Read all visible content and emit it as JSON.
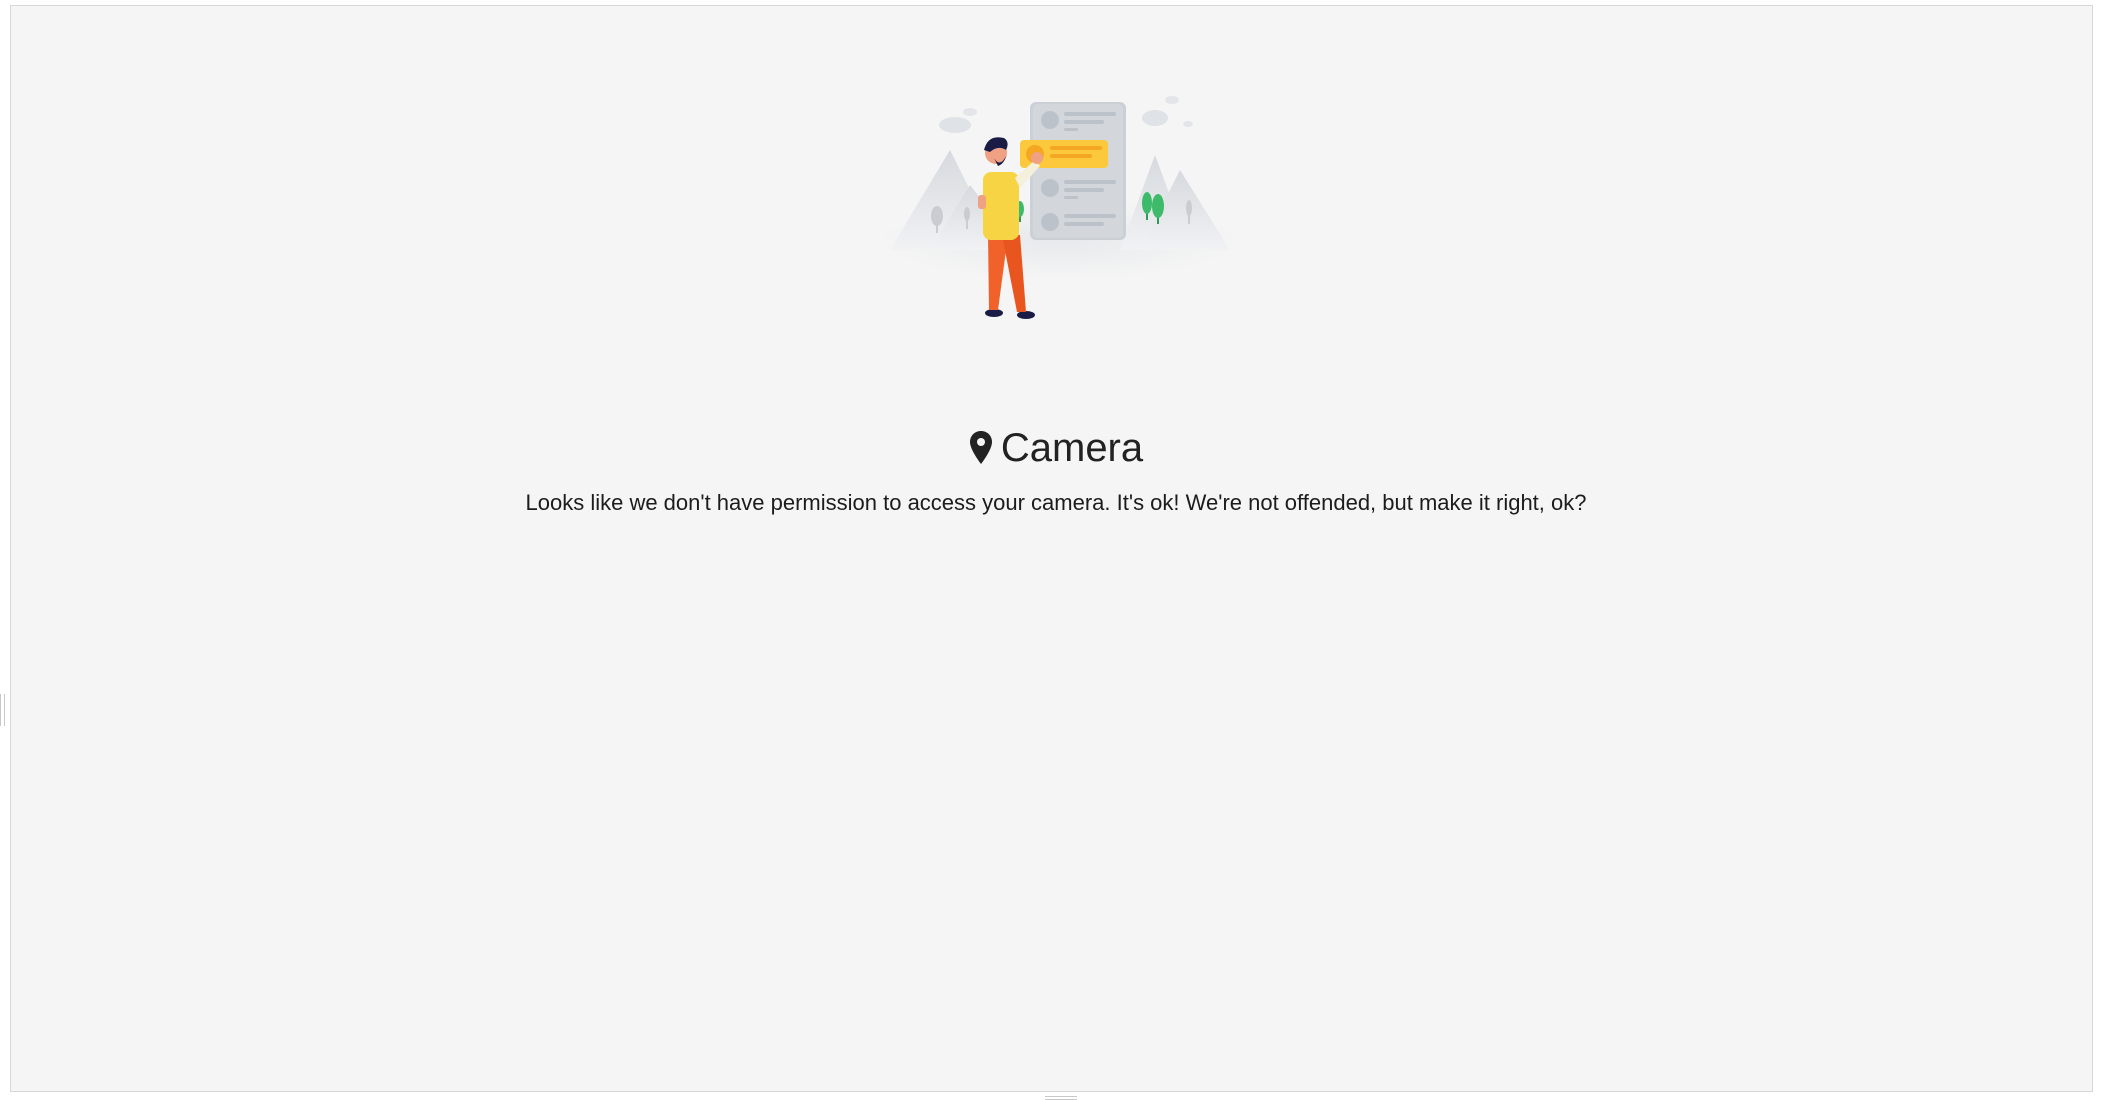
{
  "permission": {
    "title": "Camera",
    "message": "Looks like we don't have permission to access your camera. It's ok! We're not offended, but make it right, ok?",
    "title_icon": "location-pin-icon",
    "illustration": "person-with-checklist-illustration"
  },
  "colors": {
    "background": "#f5f5f5",
    "text": "#222222",
    "shirt": "#f7d443",
    "pants": "#f0622a",
    "card": "#cbd0d6",
    "highlight": "#fbc93b",
    "tree": "#3dbb6a"
  }
}
